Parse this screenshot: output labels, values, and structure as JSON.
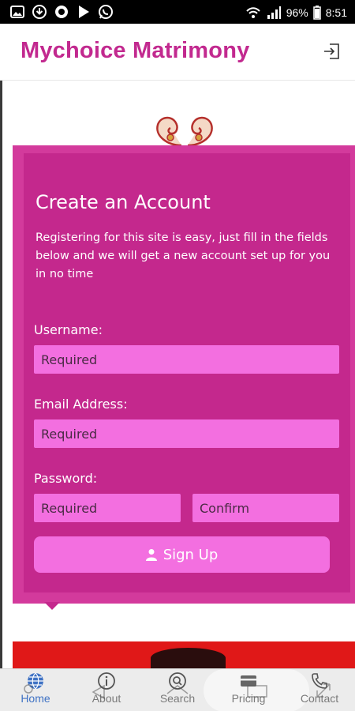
{
  "status_bar": {
    "battery": "96%",
    "time": "8:51"
  },
  "app": {
    "title": "Mychoice Matrimony"
  },
  "form": {
    "title": "Create an Account",
    "description": "Registering for this site is easy, just fill in the fields below and we will get a new account set up for you in no time",
    "username_label": "Username:",
    "username_placeholder": "Required",
    "email_label": "Email Address:",
    "email_placeholder": "Required",
    "password_label": "Password:",
    "password_placeholder": "Required",
    "confirm_placeholder": "Confirm",
    "signup_label": "Sign Up"
  },
  "nav": {
    "items": [
      {
        "label": "Home",
        "icon": "globe-icon"
      },
      {
        "label": "About",
        "icon": "info-icon"
      },
      {
        "label": "Search",
        "icon": "search-icon"
      },
      {
        "label": "Pricing",
        "icon": "card-icon"
      },
      {
        "label": "Contact",
        "icon": "phone-icon"
      }
    ]
  },
  "colors": {
    "brand": "#c2298f",
    "card": "#c4288d",
    "card_border": "#d33a9c",
    "field": "#f36fe0",
    "nav_active": "#3f72c4"
  }
}
